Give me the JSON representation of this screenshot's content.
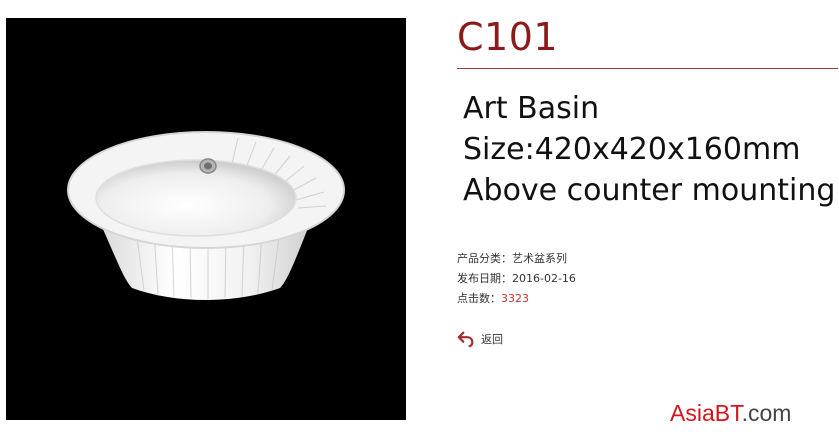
{
  "product": {
    "code": "C101",
    "lines": [
      "Art Basin",
      "Size:420x420x160mm",
      "Above counter mounting"
    ],
    "image_subject": "white fluted ceramic art basin on black background"
  },
  "meta": {
    "category_label": "产品分类：",
    "category_value": "艺术盆系列",
    "date_label": "发布日期：",
    "date_value": "2016-02-16",
    "hits_label": "点击数：",
    "hits_value": "3323"
  },
  "back": {
    "label": "返回",
    "icon": "back-arrow-icon"
  },
  "watermark": {
    "brand": "AsiaBT",
    "suffix": ".com"
  },
  "colors": {
    "title": "#8b1a1a",
    "rule": "#9e3a3a",
    "hits": "#c0392b",
    "back_icon": "#a52a2a",
    "watermark_brand": "#d4161c",
    "watermark_suffix": "#444444",
    "photo_background": "#000000"
  }
}
